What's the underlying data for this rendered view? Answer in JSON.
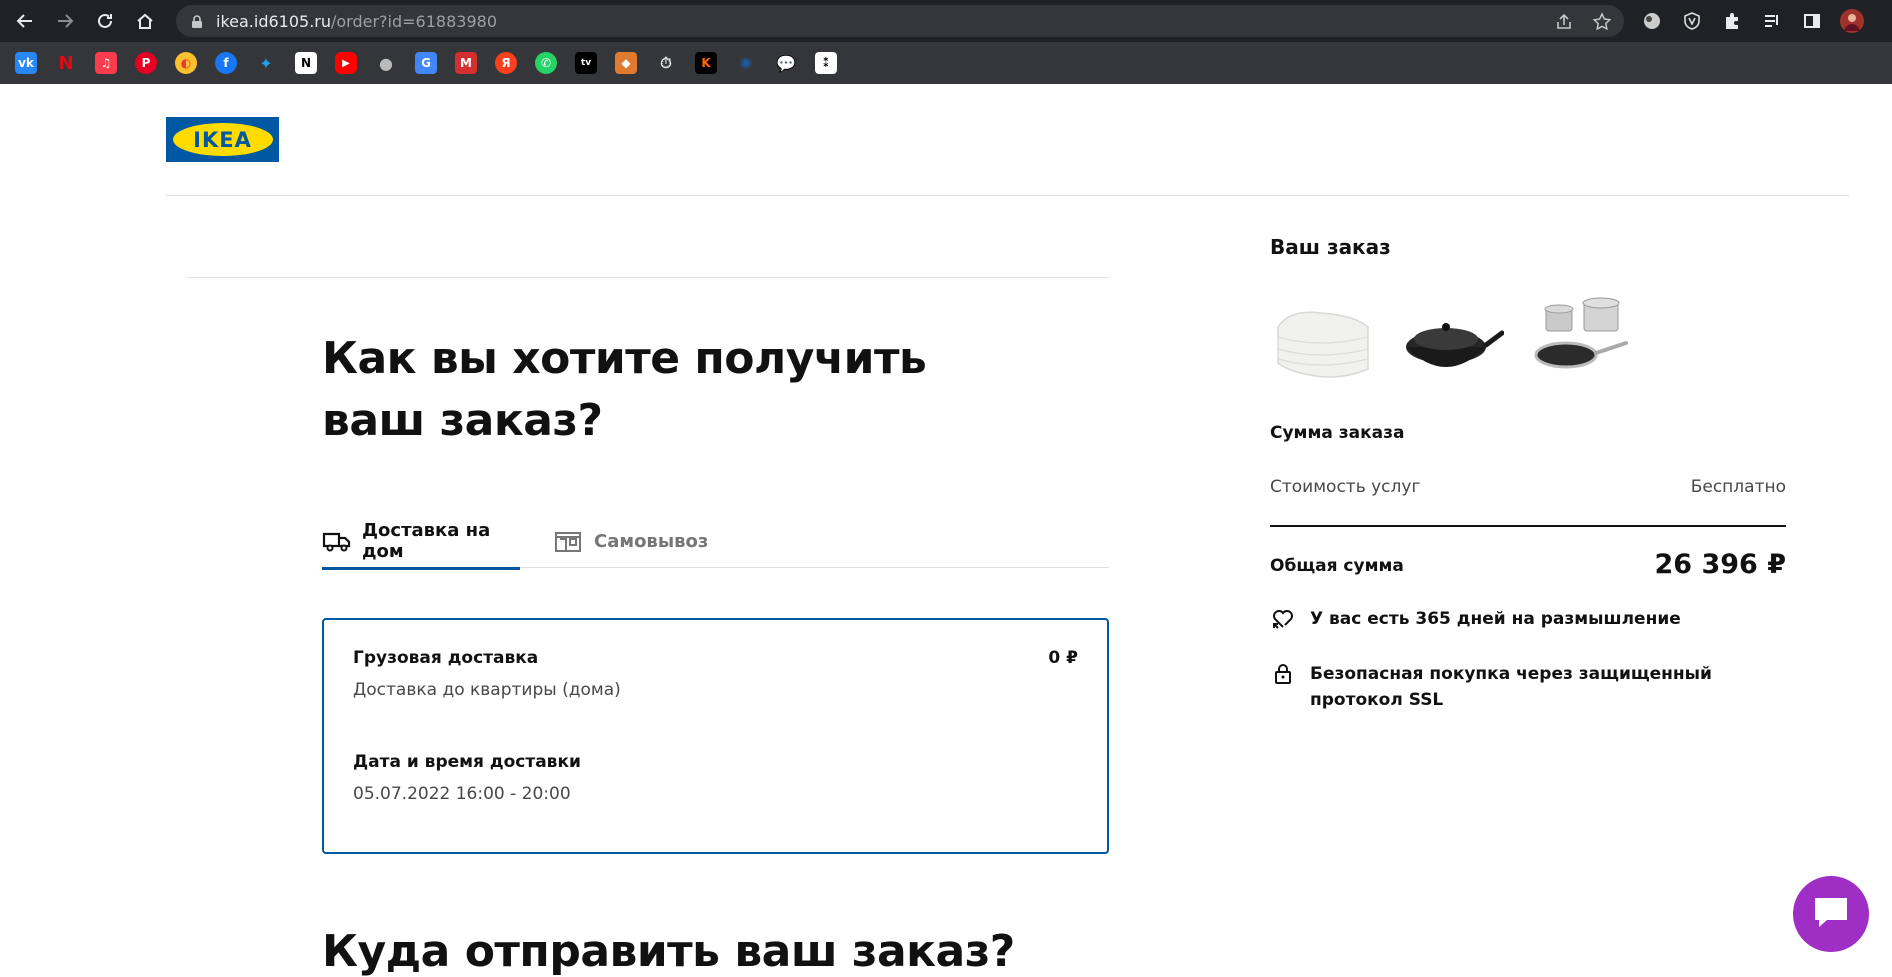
{
  "browser": {
    "url_host": "ikea.id6105.ru",
    "url_path": "/order?id=61883980",
    "bookmarks": [
      "vk",
      "netflix",
      "music",
      "pinterest",
      "yandex-eats",
      "facebook",
      "twitter",
      "notion",
      "youtube",
      "apple",
      "translate",
      "gmail",
      "yandex",
      "whatsapp",
      "apple-tv",
      "bookmark-orange",
      "timer",
      "kinopoisk",
      "bookmark-blue",
      "chat",
      "figma"
    ]
  },
  "header": {
    "logo_text": "IKEA"
  },
  "main": {
    "title": "Как вы хотите получить ваш заказ?",
    "tabs": [
      {
        "label": "Доставка на дом",
        "icon": "truck-icon",
        "active": true
      },
      {
        "label": "Самовывоз",
        "icon": "store-icon",
        "active": false
      }
    ],
    "delivery_card": {
      "title": "Грузовая доставка",
      "price": "0 ₽",
      "subtitle": "Доставка до квартиры (дома)",
      "date_title": "Дата и время доставки",
      "date_value": "05.07.2022 16:00 - 20:00"
    },
    "next_section_title": "Куда отправить ваш заказ?"
  },
  "summary": {
    "title": "Ваш заказ",
    "products": [
      "duvet",
      "wok-pan",
      "cookware-set"
    ],
    "sum_label": "Сумма заказа",
    "service_label": "Стоимость услуг",
    "service_value": "Бесплатно",
    "total_label": "Общая сумма",
    "total_value": "26 396 ₽",
    "features": [
      {
        "icon": "return-heart-icon",
        "text": "У вас есть 365 дней на размышление"
      },
      {
        "icon": "lock-icon",
        "text": "Безопасная покупка через защищенный протокол SSL"
      }
    ]
  },
  "colors": {
    "brand_blue": "#0058a3",
    "brand_yellow": "#ffdb00",
    "chat_purple": "#9e2ec4"
  }
}
